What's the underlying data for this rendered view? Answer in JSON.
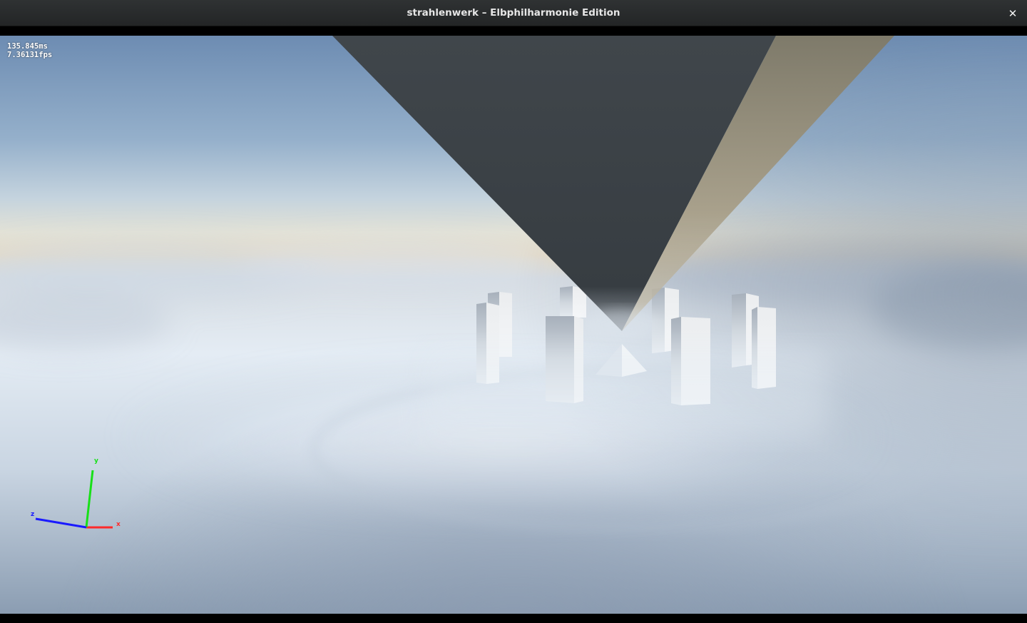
{
  "window": {
    "title": "strahlenwerk – Elbphilharmonie Edition",
    "close_glyph": "✕",
    "close_icon": "close-icon"
  },
  "stats": {
    "frame_time": "135.845ms",
    "fps": "7.36131fps"
  },
  "axis_gizmo": {
    "labels": {
      "x": "x",
      "y": "y",
      "z": "z"
    },
    "colors": {
      "x": "#ff2a2a",
      "y": "#18e018",
      "z": "#1a1aff"
    }
  },
  "scene": {
    "sky_top": "#6f8fb5",
    "horizon": "#eadfc8",
    "fog": "#dde8f2",
    "pyramid_dark": "#3a3f44",
    "pyramid_light": "#a89f8a"
  }
}
